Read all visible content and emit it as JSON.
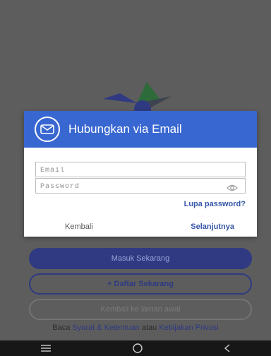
{
  "colors": {
    "overlay": "#5d5d5d",
    "dialog_header": "#3867d1",
    "primary": "#2f3a82",
    "link": "#3556a8"
  },
  "background": {
    "logo_icon": "star-logo-icon",
    "masuk_label": "Masuk Sekarang",
    "daftar_label": "+ Daftar Sekarang",
    "kembali_awal_label": "Kembali ke laman awal",
    "terms": {
      "prefix": "Baca",
      "terms_link": "Syarat & Ketentuan",
      "middle": "atau",
      "privacy_link": "Kebijakan Privasi"
    }
  },
  "dialog": {
    "icon": "mail-icon",
    "title": "Hubungkan via Email",
    "email_placeholder": "Email",
    "password_placeholder": "Password",
    "eye_icon": "eye-icon",
    "forgot_label": "Lupa password?",
    "back_label": "Kembali",
    "next_label": "Selanjutnya"
  },
  "navbar": {
    "icons": [
      "menu-icon",
      "home-icon",
      "back-icon"
    ]
  }
}
